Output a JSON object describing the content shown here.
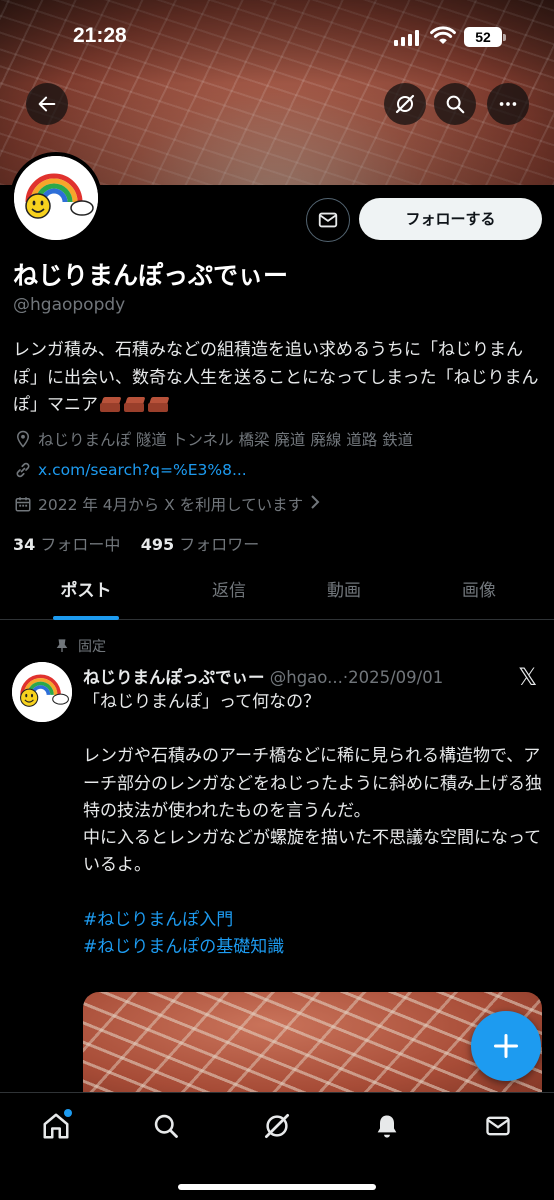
{
  "status_bar": {
    "time": "21:28",
    "battery": "52"
  },
  "header": {
    "back_icon": "arrow-left-icon",
    "action_icons": [
      "grok-icon",
      "search-icon",
      "more-icon"
    ]
  },
  "profile": {
    "display_name": "ねじりまんぽっぷでぃー",
    "handle": "@hgaopopdy",
    "follow_label": "フォローする",
    "message_icon": "mail-icon",
    "bio": "レンガ積み、石積みなどの組積造を追い求めるうちに「ねじりまんぽ」に出会い、数奇な人生を送ることになってしまった「ねじりまんぽ」マニア",
    "bio_emoji": [
      "brick",
      "brick",
      "brick"
    ],
    "location": "ねじりまんぽ 隧道 トンネル 橋梁 廃道 廃線 道路 鉄道",
    "url": "x.com/search?q=%E3%8...",
    "joined": "2022 年 4月から X を利用しています",
    "following_count": "34",
    "following_label": "フォロー中",
    "followers_count": "495",
    "followers_label": "フォロワー"
  },
  "tabs": [
    {
      "label": "ポスト",
      "active": true
    },
    {
      "label": "返信",
      "active": false
    },
    {
      "label": "動画",
      "active": false
    },
    {
      "label": "画像",
      "active": false
    }
  ],
  "post": {
    "pinned_label": "固定",
    "author_name": "ねじりまんぽっぷでぃー",
    "author_handle": "@hgao...",
    "separator": "·",
    "date": "2025/09/01",
    "lines": [
      "「ねじりまんぽ」って何なの？",
      "",
      "レンガや石積みのアーチ橋などに稀に見られる構造物で、アーチ部分のレンガなどをねじったように斜めに積み上げる独特の技法が使われたものを言うんだ。",
      "中に入るとレンガなどが螺旋を描いた不思議な空間になっているよ。",
      ""
    ],
    "hashtags": [
      "#ねじりまんぽ入門",
      "#ねじりまんぽの基礎知識"
    ]
  },
  "fab": {
    "icon": "plus-icon"
  },
  "bottom_nav": [
    "home-icon",
    "search-icon",
    "grok-icon",
    "bell-icon",
    "mail-icon"
  ],
  "colors": {
    "accent": "#1d9bf0",
    "background": "#000000",
    "muted": "#71767b"
  }
}
